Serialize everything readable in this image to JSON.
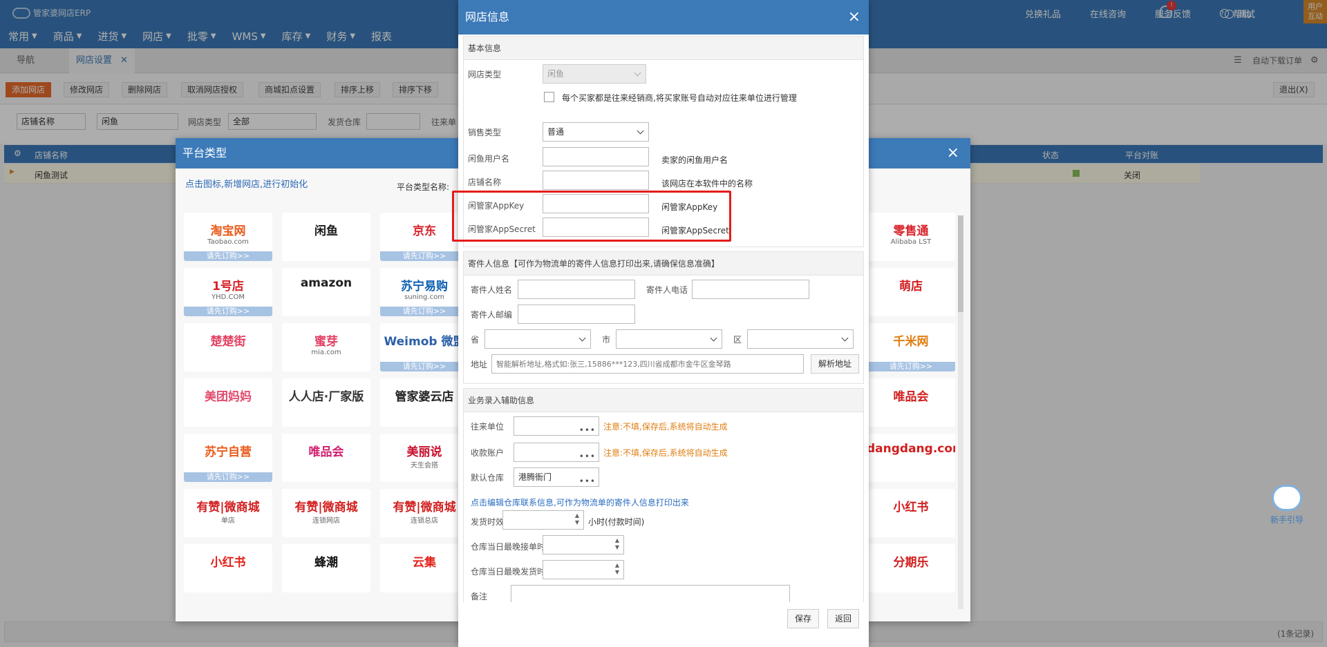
{
  "app": {
    "logo_text": "管家婆网店ERP"
  },
  "top_links": [
    "兑换礼品",
    "在线咨询",
    "服务反馈",
    "帮助"
  ],
  "notification_badge": "!",
  "user": {
    "name": "测试",
    "box_line1": "用户",
    "box_line2": "互动"
  },
  "main_nav": [
    "常用",
    "商品",
    "进货",
    "网店",
    "批零",
    "WMS",
    "库存",
    "财务",
    "报表"
  ],
  "tabs": {
    "nav": "导航",
    "active": "网店设置",
    "auto_download": "自动下载订单"
  },
  "toolbar": {
    "buttons": [
      "添加网店",
      "修改网店",
      "删除网店",
      "取消网店授权",
      "商城扣点设置",
      "排序上移",
      "排序下移"
    ],
    "exit": "退出(X)"
  },
  "filter": {
    "field": "店铺名称",
    "value": "闲鱼",
    "shop_type_label": "网店类型",
    "shop_type_value": "全部",
    "warehouse_label": "发货仓库",
    "partner_label": "往来单"
  },
  "grid": {
    "headers": [
      "店铺名称",
      "状态",
      "平台对账"
    ],
    "row": {
      "name": "闲鱼测试",
      "status_icon": "check-square",
      "reconcile": "关闭"
    },
    "record_count": "(1条记录)"
  },
  "platform_dialog": {
    "title": "平台类型",
    "hint": "点击图标,新增网店,进行初始化",
    "name_label": "平台类型名称:",
    "tiles": [
      {
        "name": "淘宝网",
        "sub": "Taobao.com",
        "footer": "请先订购>>"
      },
      {
        "name": "闲鱼",
        "sub": "",
        "footer": ""
      },
      {
        "name": "京东",
        "sub": "",
        "footer": "请先订购>>"
      },
      {
        "name": "1号店",
        "sub": "YHD.COM",
        "footer": "请先订购>>"
      },
      {
        "name": "amazon",
        "sub": "",
        "footer": ""
      },
      {
        "name": "苏宁易购",
        "sub": "suning.com",
        "footer": "请先订购>>"
      },
      {
        "name": "楚楚街",
        "sub": "",
        "footer": ""
      },
      {
        "name": "蜜芽",
        "sub": "mia.com",
        "footer": ""
      },
      {
        "name": "Weimob 微盟",
        "sub": "",
        "footer": "请先订购>>"
      },
      {
        "name": "美团妈妈",
        "sub": "",
        "footer": ""
      },
      {
        "name": "人人店·厂家版",
        "sub": "",
        "footer": ""
      },
      {
        "name": "管家婆云店",
        "sub": "",
        "footer": ""
      },
      {
        "name": "苏宁自营",
        "sub": "",
        "footer": "请先订购>>"
      },
      {
        "name": "唯品会",
        "sub": "",
        "footer": ""
      },
      {
        "name": "美丽说",
        "sub": "天生会搭",
        "footer": ""
      },
      {
        "name": "有赞|微商城",
        "sub": "单店",
        "footer": ""
      },
      {
        "name": "有赞|微商城",
        "sub": "连锁网店",
        "footer": ""
      },
      {
        "name": "有赞|微商城",
        "sub": "连锁总店",
        "footer": ""
      },
      {
        "name": "小红书",
        "sub": "",
        "footer": ""
      },
      {
        "name": "蜂潮",
        "sub": "",
        "footer": ""
      },
      {
        "name": "云集",
        "sub": "",
        "footer": ""
      }
    ],
    "right_tiles": [
      {
        "name": "零售通",
        "sub": "Alibaba LST",
        "footer": ""
      },
      {
        "name": "萌店",
        "sub": "",
        "footer": ""
      },
      {
        "name": "千米网",
        "sub": "",
        "footer": "请先订购>>"
      },
      {
        "name": "唯品会",
        "sub": "",
        "footer": ""
      },
      {
        "name": "dangdang.com",
        "sub": "",
        "footer": ""
      },
      {
        "name": "小红书",
        "sub": "",
        "footer": ""
      },
      {
        "name": "分期乐",
        "sub": "",
        "footer": ""
      }
    ]
  },
  "help_bot": "新手引导",
  "shop_dialog": {
    "title": "网店信息",
    "basic": {
      "title": "基本信息",
      "shop_type_label": "网店类型",
      "shop_type_value": "闲鱼",
      "buyer_checkbox": "每个买家都是往来经销商,将买家账号自动对应往来单位进行管理",
      "sale_type_label": "销售类型",
      "sale_type_value": "普通",
      "username_label": "闲鱼用户名",
      "username_note": "卖家的闲鱼用户名",
      "store_name_label": "店铺名称",
      "store_name_note": "该网店在本软件中的名称",
      "appkey_label": "闲管家AppKey",
      "appkey_note": "闲管家AppKey",
      "appsecret_label": "闲管家AppSecret",
      "appsecret_note": "闲管家AppSecret"
    },
    "sender": {
      "title": "寄件人信息【可作为物流单的寄件人信息打印出来,请确保信息准确】",
      "name_label": "寄件人姓名",
      "phone_label": "寄件人电话",
      "zip_label": "寄件人邮编",
      "province_label": "省",
      "city_label": "市",
      "district_label": "区",
      "address_label": "地址",
      "address_placeholder": "智能解析地址,格式如:张三,15886***123,四川省成都市金牛区金琴路",
      "parse_button": "解析地址"
    },
    "business": {
      "title": "业务录入辅助信息",
      "partner_label": "往来单位",
      "partner_warn": "注意:不填,保存后,系统将自动生成",
      "account_label": "收款账户",
      "account_warn": "注意:不填,保存后,系统将自动生成",
      "warehouse_label": "默认仓库",
      "warehouse_value": "港腾衙门",
      "edit_link": "点击编辑仓库联系信息,可作为物流单的寄件人信息打印出来",
      "ship_time_label": "发货时效",
      "ship_time_unit": "小时(付款时间)",
      "latest_receive_label": "仓库当日最晚接单时间",
      "latest_ship_label": "仓库当日最晚发货时间",
      "remark_label": "备注"
    },
    "buttons": {
      "save": "保存",
      "back": "返回"
    },
    "ellipsis": "•••",
    "close": "×"
  }
}
